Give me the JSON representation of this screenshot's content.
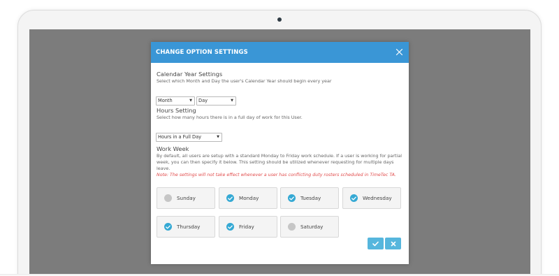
{
  "modal": {
    "title": "CHANGE OPTION SETTINGS"
  },
  "calendar": {
    "title": "Calendar Year Settings",
    "description": "Select which Month and Day the user's Calendar Year should begin every year",
    "month_value": "Month",
    "day_value": "Day"
  },
  "hours": {
    "title": "Hours Setting",
    "description": "Select how many hours there is in a full day of work for this User.",
    "value": "Hours in a Full Day"
  },
  "work_week": {
    "title": "Work Week",
    "description": "By default, all users are setup with a standard Monday to Friday work schedule. If a user is working for partial week, you can then specify it below. This setting should be utilized whenever requesting for multiple days leave.",
    "note": "Note: The settings will not take effect whenever a user has conflicting duty rosters scheduled in TimeTec TA.",
    "days": [
      {
        "label": "Sunday",
        "checked": false
      },
      {
        "label": "Monday",
        "checked": true
      },
      {
        "label": "Tuesday",
        "checked": true
      },
      {
        "label": "Wednesday",
        "checked": true
      },
      {
        "label": "Thursday",
        "checked": true
      },
      {
        "label": "Friday",
        "checked": true
      },
      {
        "label": "Saturday",
        "checked": false
      }
    ]
  },
  "icons": {
    "close": "close-icon",
    "confirm": "check-icon",
    "cancel": "cross-icon",
    "caret": "caret-down-icon"
  },
  "colors": {
    "header": "#3a96d6",
    "checked": "#35a9d4",
    "unchecked": "#c6c6c6",
    "note": "#e14b4b",
    "button": "#56b6dd"
  }
}
